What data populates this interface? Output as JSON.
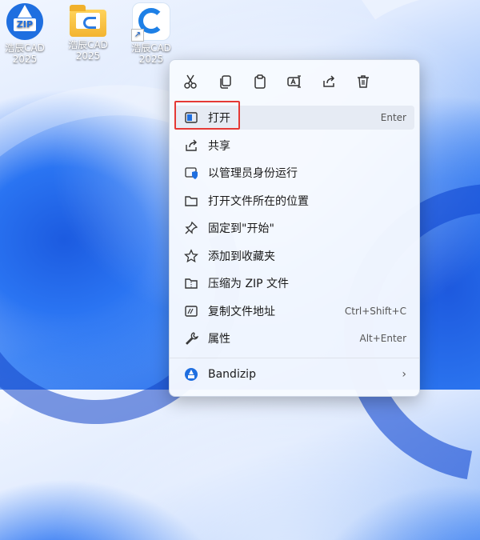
{
  "desktop": {
    "icons": [
      {
        "label_line1": "浩辰CAD",
        "label_line2": "2025",
        "badge": "ZIP",
        "icon": "bandizip-icon"
      },
      {
        "label_line1": "浩辰CAD",
        "label_line2": "2025",
        "icon": "folder-icon"
      },
      {
        "label_line1": "浩辰CAD",
        "label_line2": "2025",
        "icon": "gstarcad-icon"
      }
    ]
  },
  "context_menu": {
    "toolbar": [
      "cut-icon",
      "copy-icon",
      "paste-icon",
      "rename-icon",
      "share-icon",
      "delete-icon"
    ],
    "items": [
      {
        "label": "打开",
        "shortcut": "Enter",
        "icon": "open-app-icon"
      },
      {
        "label": "共享",
        "shortcut": "",
        "icon": "share-icon"
      },
      {
        "label": "以管理员身份运行",
        "shortcut": "",
        "icon": "shield-icon"
      },
      {
        "label": "打开文件所在的位置",
        "shortcut": "",
        "icon": "folder-open-icon"
      },
      {
        "label": "固定到\"开始\"",
        "shortcut": "",
        "icon": "pin-icon"
      },
      {
        "label": "添加到收藏夹",
        "shortcut": "",
        "icon": "star-icon"
      },
      {
        "label": "压缩为 ZIP 文件",
        "shortcut": "",
        "icon": "zip-archive-icon"
      },
      {
        "label": "复制文件地址",
        "shortcut": "Ctrl+Shift+C",
        "icon": "copy-path-icon"
      },
      {
        "label": "属性",
        "shortcut": "Alt+Enter",
        "icon": "wrench-icon"
      },
      {
        "label": "Bandizip",
        "shortcut": "",
        "icon": "bandizip-icon",
        "submenu": true
      }
    ]
  },
  "colors": {
    "highlight": "#e53935",
    "accent": "#1f6fe0"
  }
}
